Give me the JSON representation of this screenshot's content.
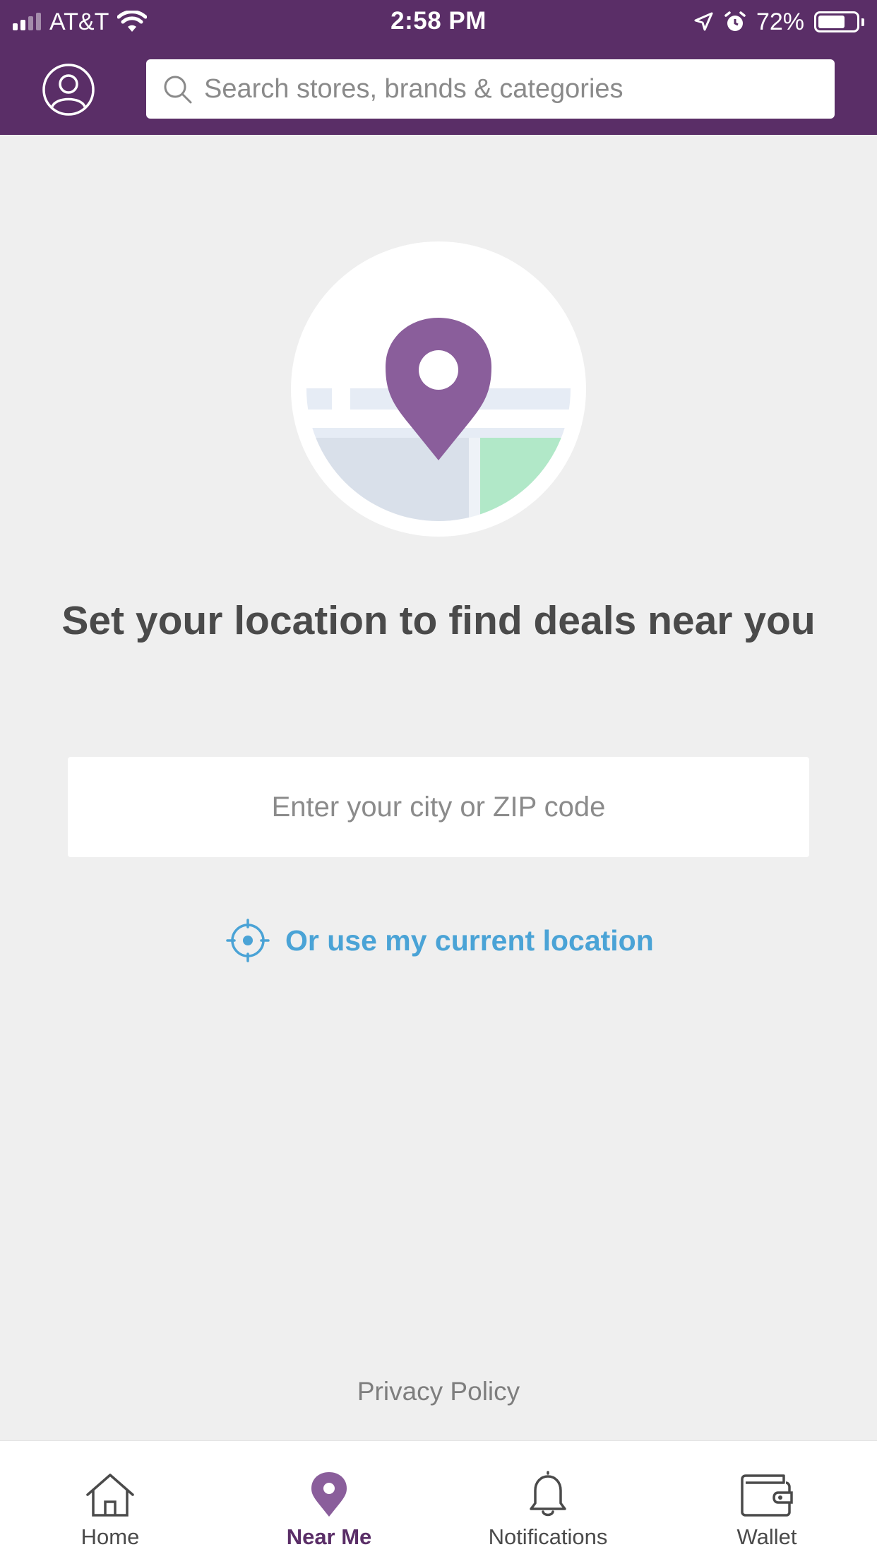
{
  "status_bar": {
    "carrier": "AT&T",
    "time": "2:58 PM",
    "battery": "72%",
    "battery_level": 0.72
  },
  "header": {
    "search_placeholder": "Search stores, brands & categories"
  },
  "main": {
    "headline": "Set your location to find deals near you",
    "city_placeholder": "Enter your city or ZIP code",
    "current_location_label": "Or use my current location",
    "privacy_label": "Privacy Policy"
  },
  "tabs": [
    {
      "label": "Home",
      "icon": "home-icon",
      "active": false
    },
    {
      "label": "Near Me",
      "icon": "location-pin-icon",
      "active": true
    },
    {
      "label": "Notifications",
      "icon": "bell-icon",
      "active": false
    },
    {
      "label": "Wallet",
      "icon": "wallet-icon",
      "active": false
    }
  ],
  "colors": {
    "header_purple": "#5a2e67",
    "pin_purple": "#8a5e9b",
    "link_blue": "#4aa3d6",
    "map_green": "#b1e8c8",
    "background": "#efefef"
  }
}
